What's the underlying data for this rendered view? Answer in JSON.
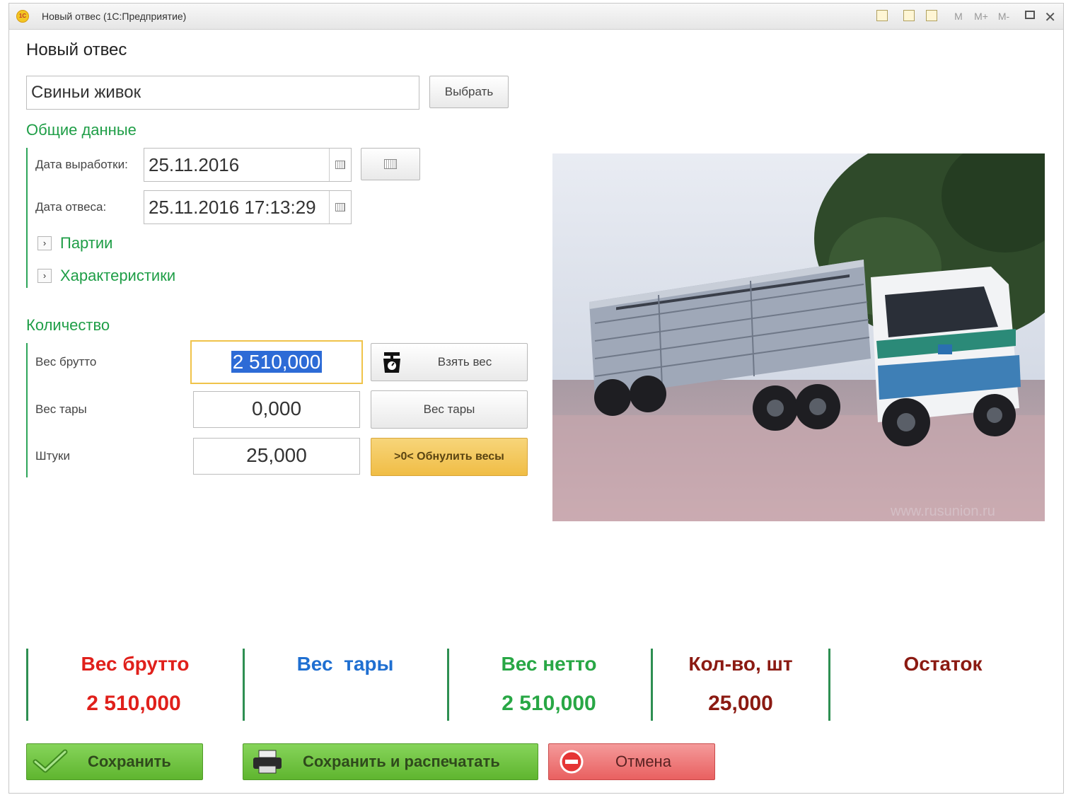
{
  "window": {
    "title": "Новый отвес  (1С:Предприятие)",
    "toolbar": {
      "m": "M",
      "m_plus": "M+",
      "m_minus": "M-",
      "close": "✕"
    }
  },
  "form": {
    "title": "Новый отвес",
    "product": {
      "value": "Свиньи живок",
      "select_label": "Выбрать"
    }
  },
  "general": {
    "title": "Общие данные",
    "production_date_label": "Дата выработки:",
    "production_date_value": "25.11.2016",
    "weigh_date_label": "Дата отвеса:",
    "weigh_date_value": "25.11.2016 17:13:29",
    "batches_label": "Партии",
    "characteristics_label": "Характеристики"
  },
  "quantity": {
    "title": "Количество",
    "gross_label": "Вес брутто",
    "gross_value": "2 510,000",
    "take_weight_label": "Взять вес",
    "tare_label": "Вес тары",
    "tare_value": "0,000",
    "tare_button_label": "Вес тары",
    "pieces_label": "Штуки",
    "pieces_value": "25,000",
    "zero_button_label": ">0< Обнулить весы"
  },
  "photo": {
    "watermark": "www.rusunion.ru"
  },
  "totals": {
    "gross": {
      "title": "Вес брутто",
      "value": "2 510,000"
    },
    "tare": {
      "title": "Вес  тары",
      "value": ""
    },
    "net": {
      "title": "Вес нетто",
      "value": "2 510,000"
    },
    "count": {
      "title": "Кол-во, шт",
      "value": "25,000"
    },
    "rest": {
      "title": "Остаток",
      "value": ""
    }
  },
  "actions": {
    "save": "Сохранить",
    "save_print": "Сохранить и распечатать",
    "cancel": "Отмена"
  },
  "colors": {
    "green": "#1f9e47",
    "gross_red": "#e0201b",
    "tare_blue": "#1f6fd1",
    "net_green": "#28a745",
    "count_dark_red": "#8b1a12",
    "save_green": "#6fc23c",
    "cancel_red": "#ee6b6b",
    "zero_yellow": "#f2c24b"
  }
}
